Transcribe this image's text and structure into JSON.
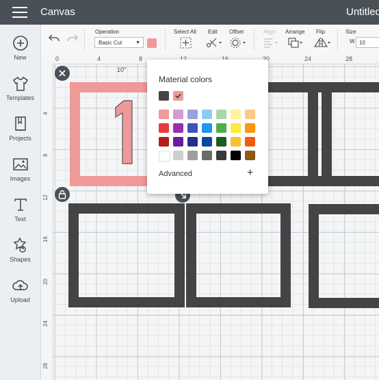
{
  "header": {
    "title": "Canvas",
    "document_name": "Untitled"
  },
  "nav": [
    {
      "label": "New",
      "icon": "plus-circle-icon"
    },
    {
      "label": "Templates",
      "icon": "shirt-icon"
    },
    {
      "label": "Projects",
      "icon": "bookmark-book-icon"
    },
    {
      "label": "Images",
      "icon": "image-icon"
    },
    {
      "label": "Text",
      "icon": "text-t-icon"
    },
    {
      "label": "Shapes",
      "icon": "shapes-icon"
    },
    {
      "label": "Upload",
      "icon": "cloud-upload-icon"
    }
  ],
  "toolbar": {
    "operation_label": "Operation",
    "operation_value": "Basic Cut",
    "select_all_label": "Select All",
    "edit_label": "Edit",
    "offset_label": "Offset",
    "align_label": "Align",
    "arrange_label": "Arrange",
    "flip_label": "Flip",
    "size_label": "Size",
    "size_w_label": "W",
    "size_w_value": "10",
    "material_color": "#f09a9b"
  },
  "ruler": {
    "top": [
      "0",
      "4",
      "8",
      "12",
      "16",
      "20",
      "24",
      "28"
    ],
    "left": [
      "4",
      "8",
      "12",
      "16",
      "20",
      "24",
      "28"
    ]
  },
  "canvas": {
    "dimension_label": "10\"",
    "number_text": "1",
    "colors": {
      "frame": "#444446",
      "selected_frame": "#ef9999"
    }
  },
  "popup": {
    "title": "Material colors",
    "advanced_label": "Advanced",
    "recent_colors": [
      "#444446",
      "#ef9999"
    ],
    "palette": [
      [
        "#f09a9b",
        "#d59ad6",
        "#9aa3d9",
        "#8ecbf2",
        "#a8d8a9",
        "#fff29a",
        "#fcc987"
      ],
      [
        "#ec3a3c",
        "#9a2eb0",
        "#3d55b7",
        "#1f96f0",
        "#49b04b",
        "#fdeb3b",
        "#fd9512"
      ],
      [
        "#b51c1c",
        "#6a1c9c",
        "#222f8c",
        "#0d47a1",
        "#1b5e20",
        "#fbc02d",
        "#f25a10"
      ],
      [
        "#ffffff",
        "#cfcfcf",
        "#9e9e9e",
        "#6a6a6a",
        "#3a3a3a",
        "#000000",
        "#8c5a12"
      ]
    ]
  }
}
